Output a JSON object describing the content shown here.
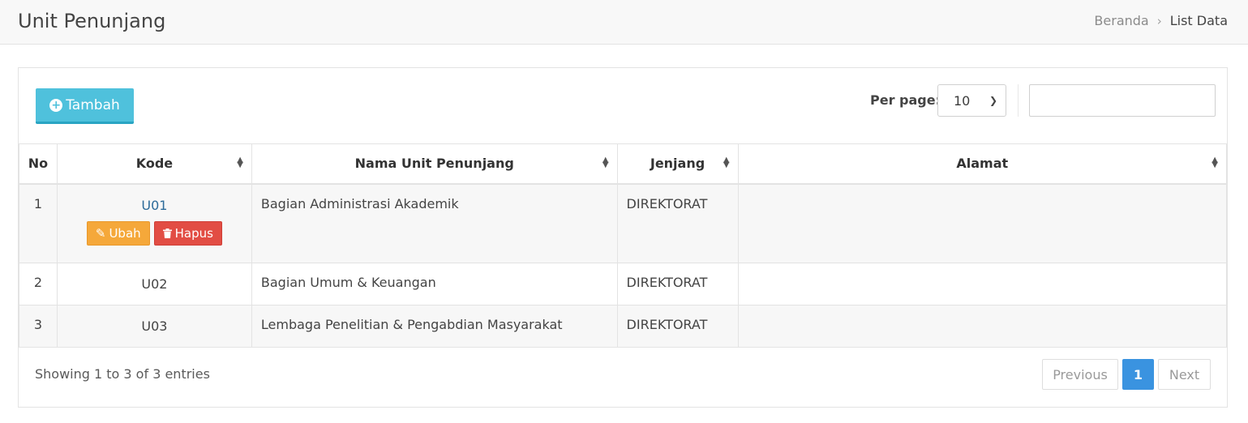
{
  "header": {
    "title": "Unit Penunjang",
    "breadcrumb": {
      "home": "Beranda",
      "separator": "›",
      "current": "List Data"
    }
  },
  "toolbar": {
    "add_label": "Tambah",
    "perpage_label": "Per page:",
    "perpage_value": "10",
    "search_value": ""
  },
  "table": {
    "columns": [
      "No",
      "Kode",
      "Nama Unit Penunjang",
      "Jenjang",
      "Alamat"
    ],
    "rows": [
      {
        "no": "1",
        "kode": "U01",
        "nama": "Bagian Administrasi Akademik",
        "jenjang": "DIREKTORAT",
        "alamat": ""
      },
      {
        "no": "2",
        "kode": "U02",
        "nama": "Bagian Umum & Keuangan",
        "jenjang": "DIREKTORAT",
        "alamat": ""
      },
      {
        "no": "3",
        "kode": "U03",
        "nama": "Lembaga Penelitian & Pengabdian Masyarakat",
        "jenjang": "DIREKTORAT",
        "alamat": ""
      }
    ],
    "row_actions": {
      "edit_label": "Ubah",
      "delete_label": "Hapus"
    }
  },
  "footer": {
    "info": "Showing 1 to 3 of 3 entries",
    "pagination": {
      "previous": "Previous",
      "page": "1",
      "next": "Next"
    }
  },
  "colors": {
    "add_button": "#4fc1dc",
    "edit_button": "#f5a83a",
    "delete_button": "#e24d44",
    "active_page": "#3a93e0"
  }
}
